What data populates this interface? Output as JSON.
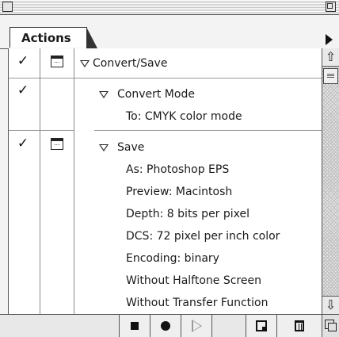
{
  "window": {
    "tab_label": "Actions",
    "icons": {
      "close": "close-box-icon",
      "zoom": "zoom-box-icon",
      "menu": "palette-menu-arrow-icon",
      "grow": "resize-grow-icon"
    }
  },
  "actions": {
    "set": {
      "label": "Convert/Save",
      "enabled": true,
      "dialog": true,
      "expanded": true
    },
    "convert_mode": {
      "label": "Convert Mode",
      "enabled": true,
      "dialog": false,
      "expanded": true,
      "details": [
        "To: CMYK color mode"
      ]
    },
    "save": {
      "label": "Save",
      "enabled": true,
      "dialog": true,
      "expanded": true,
      "details": [
        "As: Photoshop EPS",
        "Preview: Macintosh",
        "Depth: 8 bits per pixel",
        "DCS: 72 pixel per inch color",
        "Encoding: binary",
        "Without Halftone Screen",
        "Without Transfer Function"
      ]
    }
  },
  "toolbar": {
    "buttons": [
      "stop-icon",
      "record-icon",
      "play-icon",
      "new-action-icon",
      "trash-icon"
    ]
  },
  "colors": {
    "panel": "#f3f3f3",
    "list": "#ffffff",
    "border": "#555555",
    "text": "#1a1a1a"
  }
}
